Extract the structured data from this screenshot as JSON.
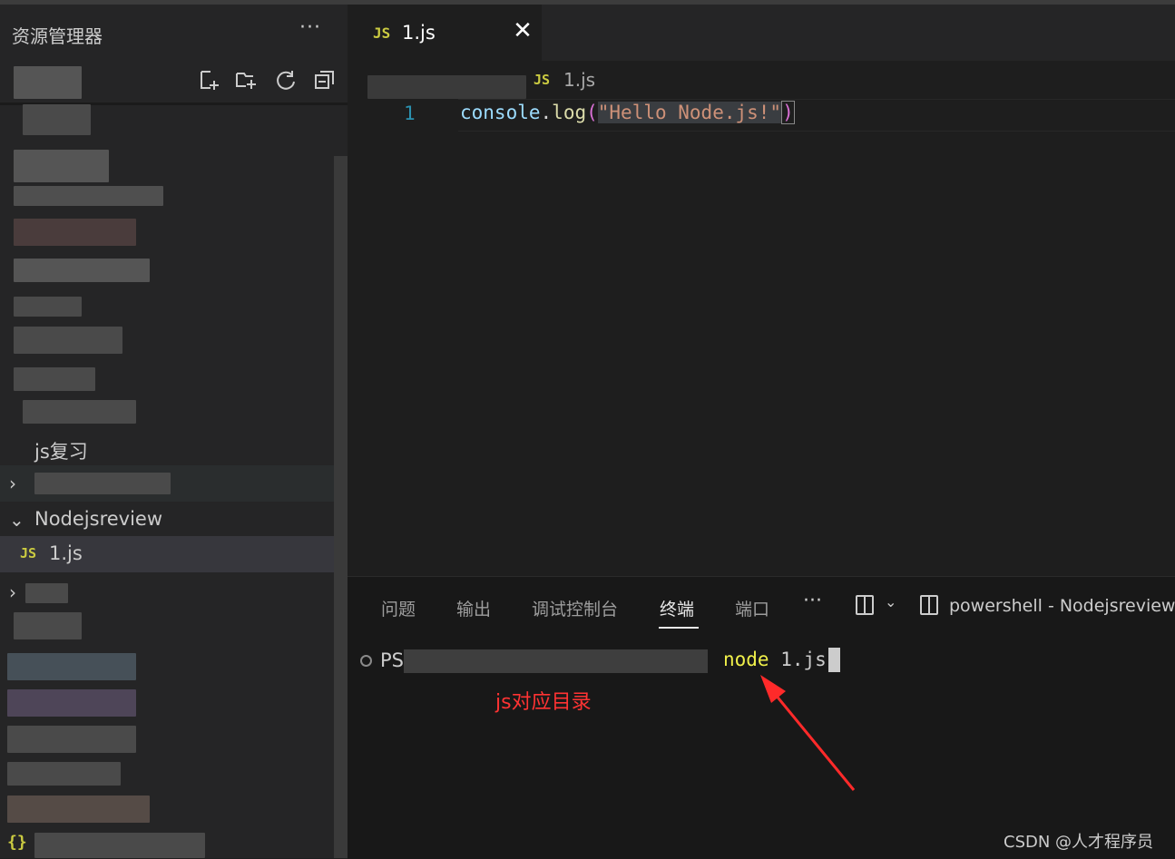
{
  "sidebar": {
    "title": "资源管理器",
    "more": "···",
    "items": {
      "js_review": "js复习",
      "nodejsreview_folder": "Nodejsreview",
      "file_1js": "1.js"
    }
  },
  "tabs": {
    "active": {
      "icon": "JS",
      "label": "1.js",
      "close": "✕"
    }
  },
  "breadcrumb": {
    "icon": "JS",
    "file": "1.js"
  },
  "code": {
    "line_number": "1",
    "obj": "console",
    "dot": ".",
    "fn": "log",
    "open": "(",
    "str": "\"Hello Node.js!\"",
    "close": ")"
  },
  "panel": {
    "tabs": [
      "问题",
      "输出",
      "调试控制台",
      "终端",
      "端口"
    ],
    "more": "···",
    "chevron": "⌄",
    "terminal_name": "powershell - Nodejsreview"
  },
  "terminal": {
    "prompt": "PS",
    "cmd_node": "node",
    "cmd_arg": " 1.js"
  },
  "annotation": "js对应目录",
  "watermark": "CSDN @人才程序员",
  "colors": {
    "accent_js": "#cbcb41",
    "annotation": "#ff3333"
  }
}
